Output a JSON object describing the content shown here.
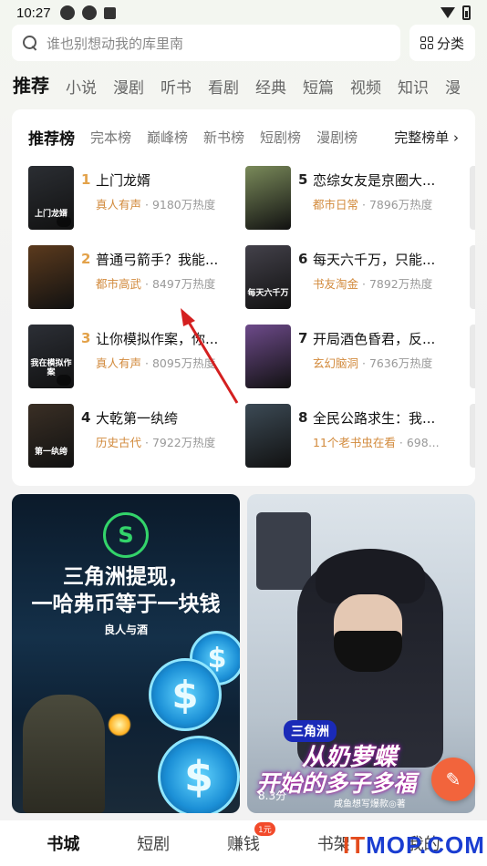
{
  "status": {
    "time": "10:27"
  },
  "search": {
    "placeholder": "谁也别想动我的库里南"
  },
  "category_button": "分类",
  "tabs": [
    "推荐",
    "小说",
    "漫剧",
    "听书",
    "看剧",
    "经典",
    "短篇",
    "视频",
    "知识",
    "漫"
  ],
  "rank_tabs": [
    "推荐榜",
    "完本榜",
    "巅峰榜",
    "新书榜",
    "短剧榜",
    "漫剧榜"
  ],
  "rank_more": "完整榜单 ›",
  "rank_items": [
    {
      "rank": "1",
      "title": "上门龙婿",
      "tag": "真人有声",
      "heat": "9180万热度",
      "cover_text": "上门龙婿",
      "color_rank": "#e3a24a",
      "cover": "#2b2e33"
    },
    {
      "rank": "2",
      "title": "普通弓箭手？我能...",
      "tag": "都市高武",
      "heat": "8497万热度",
      "cover_text": "",
      "color_rank": "#e3a24a",
      "cover": "#5b3a1d"
    },
    {
      "rank": "3",
      "title": "让你模拟作案，你...",
      "tag": "真人有声",
      "heat": "8095万热度",
      "cover_text": "我在模拟作案",
      "color_rank": "#e3a24a",
      "cover": "#2c2f36"
    },
    {
      "rank": "4",
      "title": "大乾第一纨绔",
      "tag": "历史古代",
      "heat": "7922万热度",
      "cover_text": "第一纨绔",
      "color_rank": "#222222",
      "cover": "#3a2f25"
    },
    {
      "rank": "5",
      "title": "恋综女友是京圈大...",
      "tag": "都市日常",
      "heat": "7896万热度",
      "cover_text": "",
      "color_rank": "#222222",
      "cover": "#7a8a5a"
    },
    {
      "rank": "6",
      "title": "每天六千万，只能...",
      "tag": "书友淘金",
      "heat": "7892万热度",
      "cover_text": "每天六千万",
      "color_rank": "#222222",
      "cover": "#43414a"
    },
    {
      "rank": "7",
      "title": "开局酒色昏君，反...",
      "tag": "玄幻脑洞",
      "heat": "7636万热度",
      "cover_text": "",
      "color_rank": "#222222",
      "cover": "#6d4a8a"
    },
    {
      "rank": "8",
      "title": "全民公路求生：我...",
      "tag": "11个老书虫在看",
      "heat": "698...",
      "cover_text": "",
      "color_rank": "#222222",
      "cover": "#3c4a55"
    }
  ],
  "banner1": {
    "logo": "S",
    "title_line1": "三角洲提现，",
    "title_line2": "一哈弗币等于一块钱",
    "author": "良人与酒",
    "coin_symbol": "$"
  },
  "banner2": {
    "brand": "三角洲",
    "line1": "从奶萝蝶",
    "line2": "开始的多子多福",
    "author": "咸鱼想写爆款◎著",
    "score": "8.3分"
  },
  "fab_icon": "feather-icon",
  "bottom_nav": [
    {
      "label": "书城",
      "active": true
    },
    {
      "label": "短剧",
      "active": false
    },
    {
      "label": "赚钱",
      "active": false,
      "badge": "1元"
    },
    {
      "label": "书架",
      "active": false
    },
    {
      "label": "我的",
      "active": false
    }
  ],
  "watermark": {
    "part1": "IT",
    "part2": "MOP.COM"
  }
}
